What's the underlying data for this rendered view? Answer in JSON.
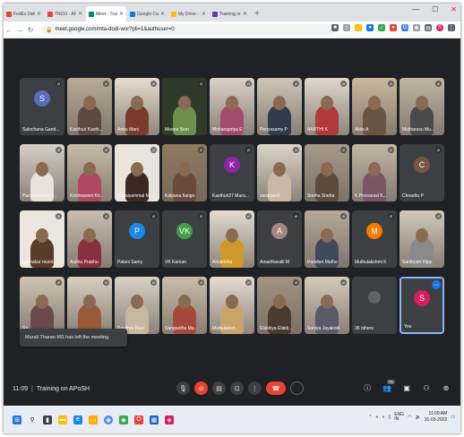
{
  "browser": {
    "tabs": [
      {
        "label": "FedEx Delivery Status N",
        "icon": "gmail-icon",
        "color": "#ea4335",
        "active": false
      },
      {
        "label": "TNOU - APoSH - Invite",
        "icon": "gmail-icon",
        "color": "#ea4335",
        "active": false
      },
      {
        "label": "Meet - Training on",
        "icon": "meet-icon",
        "color": "#00897b",
        "active": true
      },
      {
        "label": "Google Calendar - Thu",
        "icon": "calendar-icon",
        "color": "#1a73e8",
        "active": false
      },
      {
        "label": "My Drive - Google Dri",
        "icon": "drive-icon",
        "color": "#fbbc04",
        "active": false
      },
      {
        "label": "Training on APoSH - Go",
        "icon": "forms-icon",
        "color": "#673ab7",
        "active": false
      }
    ],
    "url": "meet.google.com/mta-dodi-wor?pli=1&authuser=0"
  },
  "participants": [
    {
      "name": "Sulochana Gand...",
      "type": "avatar",
      "initial": "S",
      "color": "#5c6bc0"
    },
    {
      "name": "Kasthuri Kasth...",
      "type": "video",
      "wall": "#b8aa98",
      "shirt": "#5a4a40"
    },
    {
      "name": "Anbu Mani",
      "type": "video",
      "wall": "#e6ddd0",
      "shirt": "#7a3b2c"
    },
    {
      "name": "Meena Sem",
      "type": "photo",
      "wall": "#2e3b2a",
      "shirt": "#6f8f4e"
    },
    {
      "name": "Mohanapriya E",
      "type": "video",
      "wall": "#d9d1c5",
      "shirt": "#a44a6a"
    },
    {
      "name": "Periyasamy P",
      "type": "video",
      "wall": "#cfc6b8",
      "shirt": "#2f3a4a"
    },
    {
      "name": "AARTHI K",
      "type": "video",
      "wall": "#e0d8cc",
      "shirt": "#b03a3a"
    },
    {
      "name": "Akila A",
      "type": "video",
      "wall": "#cbb89f",
      "shirt": "#6c5442"
    },
    {
      "name": "Mutharasu Mu...",
      "type": "video",
      "wall": "#bfb5a6",
      "shirt": "#4a4a4a"
    },
    {
      "name": "Pachiyammal P...",
      "type": "video",
      "wall": "#d6cfc4",
      "shirt": "#e8e2d8"
    },
    {
      "name": "Krishnaveni Kri...",
      "type": "video",
      "wall": "#c7bba8",
      "shirt": "#b04860"
    },
    {
      "name": "Kottaiyammal M...",
      "type": "photo",
      "wall": "#e9e4dc",
      "shirt": "#3a2a22"
    },
    {
      "name": "Kalpana Ilango",
      "type": "video",
      "wall": "#8f7a62",
      "shirt": "#6a4a3a"
    },
    {
      "name": "Kasthuri27 Muru...",
      "type": "avatar",
      "initial": "K",
      "color": "#8e24aa"
    },
    {
      "name": "saranya K",
      "type": "video",
      "wall": "#ddd4c8",
      "shirt": "#c9b9a4"
    },
    {
      "name": "Sneha Sneha",
      "type": "video",
      "wall": "#a89a8a",
      "shirt": "#5c4c3f"
    },
    {
      "name": "K.Poovarasi K...",
      "type": "video",
      "wall": "#c2b6a6",
      "shirt": "#7a5566"
    },
    {
      "name": "Chnadru P",
      "type": "avatar",
      "initial": "C",
      "color": "#795548"
    },
    {
      "name": "sudhakar munir...",
      "type": "photo",
      "wall": "#ebe6de",
      "shirt": "#5a3a2a"
    },
    {
      "name": "Anitha Prabhu",
      "type": "video",
      "wall": "#c9beb0",
      "shirt": "#8a2f3f"
    },
    {
      "name": "Palani Samy",
      "type": "avatar",
      "initial": "P",
      "color": "#1e88e5"
    },
    {
      "name": "VK Kaman",
      "type": "avatar",
      "initial": "VK",
      "color": "#43a047"
    },
    {
      "name": "Anusrisha",
      "type": "video",
      "wall": "#e3dbcf",
      "shirt": "#d09a2a"
    },
    {
      "name": "Amarthavalli M",
      "type": "avatar",
      "initial": "A",
      "color": "#a1887f"
    },
    {
      "name": "Pandian Muthu",
      "type": "video",
      "wall": "#b4a898",
      "shirt": "#3f4a5a"
    },
    {
      "name": "Muthulakshmi K",
      "type": "avatar",
      "initial": "M",
      "color": "#f57c00"
    },
    {
      "name": "Santhosh Vijay",
      "type": "video",
      "wall": "#d1c8bb",
      "shirt": "#8a8a8a"
    },
    {
      "name": "Ra...",
      "type": "video",
      "wall": "#cfc4b4",
      "shirt": "#6a4a4a"
    },
    {
      "name": "",
      "type": "video",
      "wall": "#d8cfc2",
      "shirt": "#9a5a3a"
    },
    {
      "name": "Pavithra Ravi",
      "type": "video",
      "wall": "#d9d2c6",
      "shirt": "#c7b6a0"
    },
    {
      "name": "Sangeetha Mu...",
      "type": "video",
      "wall": "#cabdaa",
      "shirt": "#a5473a"
    },
    {
      "name": "Muthulaksh...",
      "type": "video",
      "wall": "#e5ddd2",
      "shirt": "#caa36a"
    },
    {
      "name": "Elakkiya Elakk...",
      "type": "video",
      "wall": "#a29382",
      "shirt": "#4a3a30"
    },
    {
      "name": "Soniya Jayakodi",
      "type": "video",
      "wall": "#d4cabc",
      "shirt": "#5a5a6a"
    },
    {
      "name": "36 others",
      "type": "others",
      "color": "#3c4043"
    },
    {
      "name": "You",
      "type": "self",
      "initial": "S",
      "color": "#d81b60"
    }
  ],
  "toast": "Murali Tharan MS has left the meeting",
  "meeting": {
    "time": "11:09",
    "title": "Training on APoSH"
  },
  "controls": {
    "people_count": "71"
  },
  "taskbar": {
    "date": "31-03-2022",
    "time": "11:09 AM",
    "lang": "ENG\nIN"
  }
}
